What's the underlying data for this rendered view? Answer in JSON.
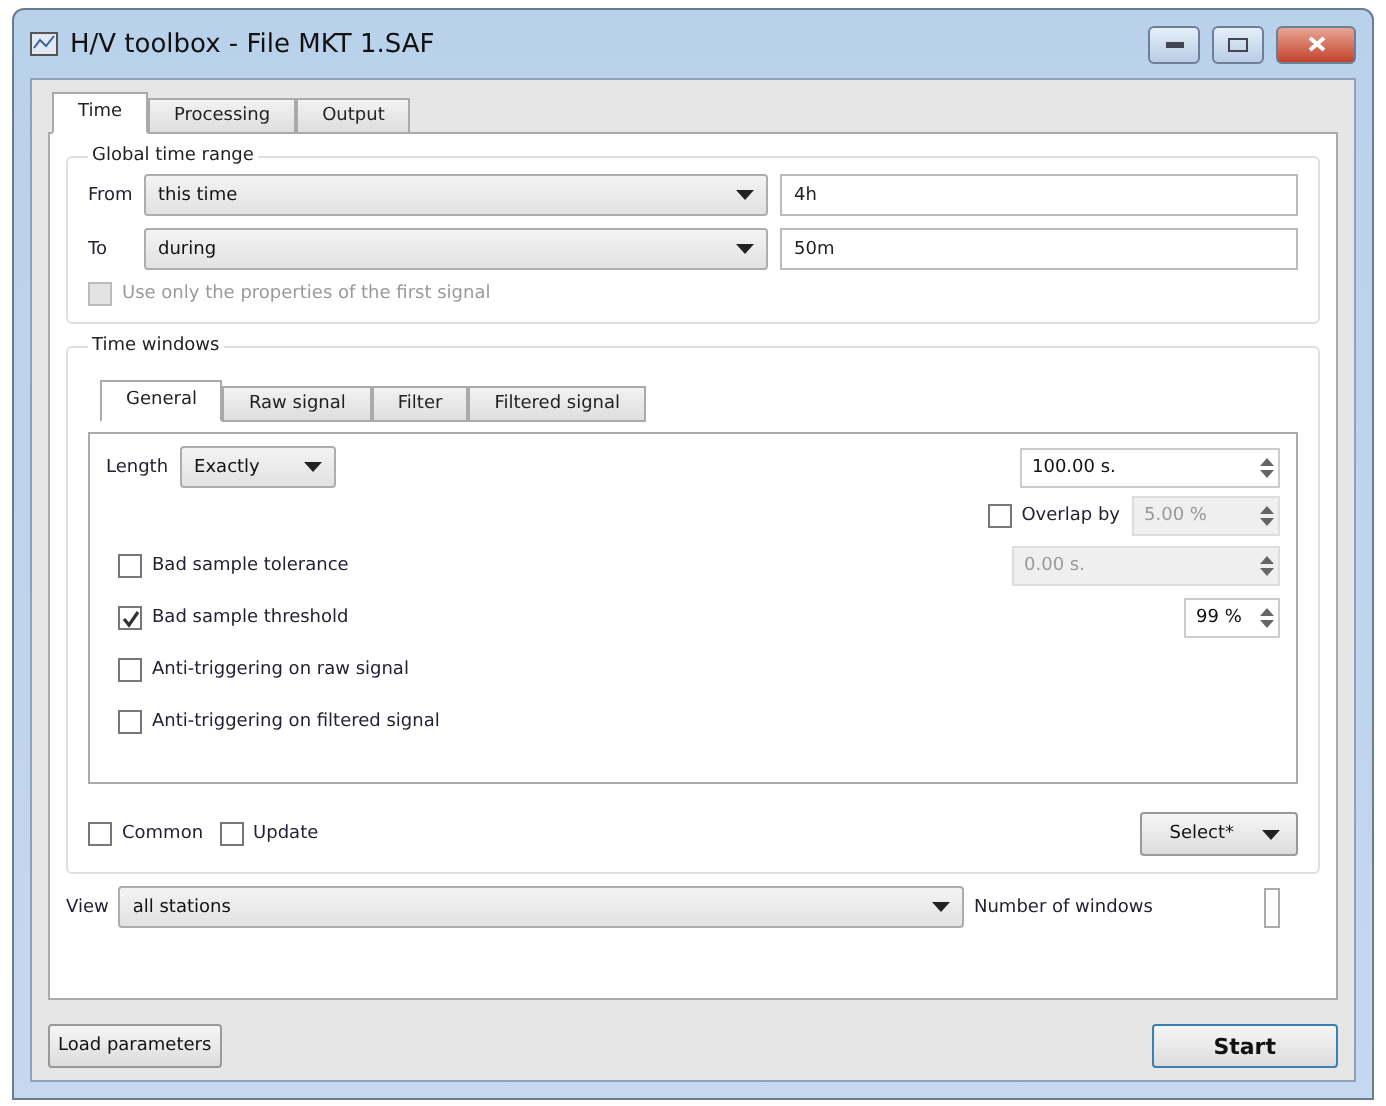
{
  "window": {
    "title": "H/V toolbox - File MKT 1.SAF"
  },
  "tabs": [
    {
      "label": "Time",
      "selected": true
    },
    {
      "label": "Processing",
      "selected": false
    },
    {
      "label": "Output",
      "selected": false
    }
  ],
  "global_time_range": {
    "title": "Global time range",
    "rows": [
      {
        "label": "From",
        "value": "this time",
        "field": "4h"
      },
      {
        "label": "To",
        "value": "during",
        "field": "50m"
      }
    ],
    "use_first_signal": {
      "label": "Use only the properties of the first signal",
      "checked": false,
      "disabled": true
    }
  },
  "time_windows": {
    "title": "Time windows",
    "tabs": [
      {
        "label": "General",
        "selected": true
      },
      {
        "label": "Raw signal",
        "selected": false
      },
      {
        "label": "Filter",
        "selected": false
      },
      {
        "label": "Filtered signal",
        "selected": false
      }
    ],
    "length": {
      "label": "Length",
      "value": "Exactly",
      "spin": "100.00 s."
    },
    "overlap": {
      "label": "Overlap by",
      "checked": false,
      "spin": "5.00 %",
      "disabled": true
    },
    "options": [
      {
        "label": "Bad sample tolerance",
        "checked": false,
        "spin": "0.00 s.",
        "spin_disabled": true
      },
      {
        "label": "Bad sample threshold",
        "checked": true,
        "spin": "99 %",
        "spin_disabled": false
      },
      {
        "label": "Anti-triggering on raw signal",
        "checked": false
      },
      {
        "label": "Anti-triggering on filtered signal",
        "checked": false
      }
    ],
    "footer_checks": [
      {
        "label": "Common",
        "checked": false
      },
      {
        "label": "Update",
        "checked": false
      }
    ],
    "select_button": "Select*"
  },
  "view": {
    "label": "View",
    "value": "all stations",
    "count_label": "Number of windows"
  },
  "buttons": {
    "load": "Load parameters",
    "start": "Start"
  }
}
